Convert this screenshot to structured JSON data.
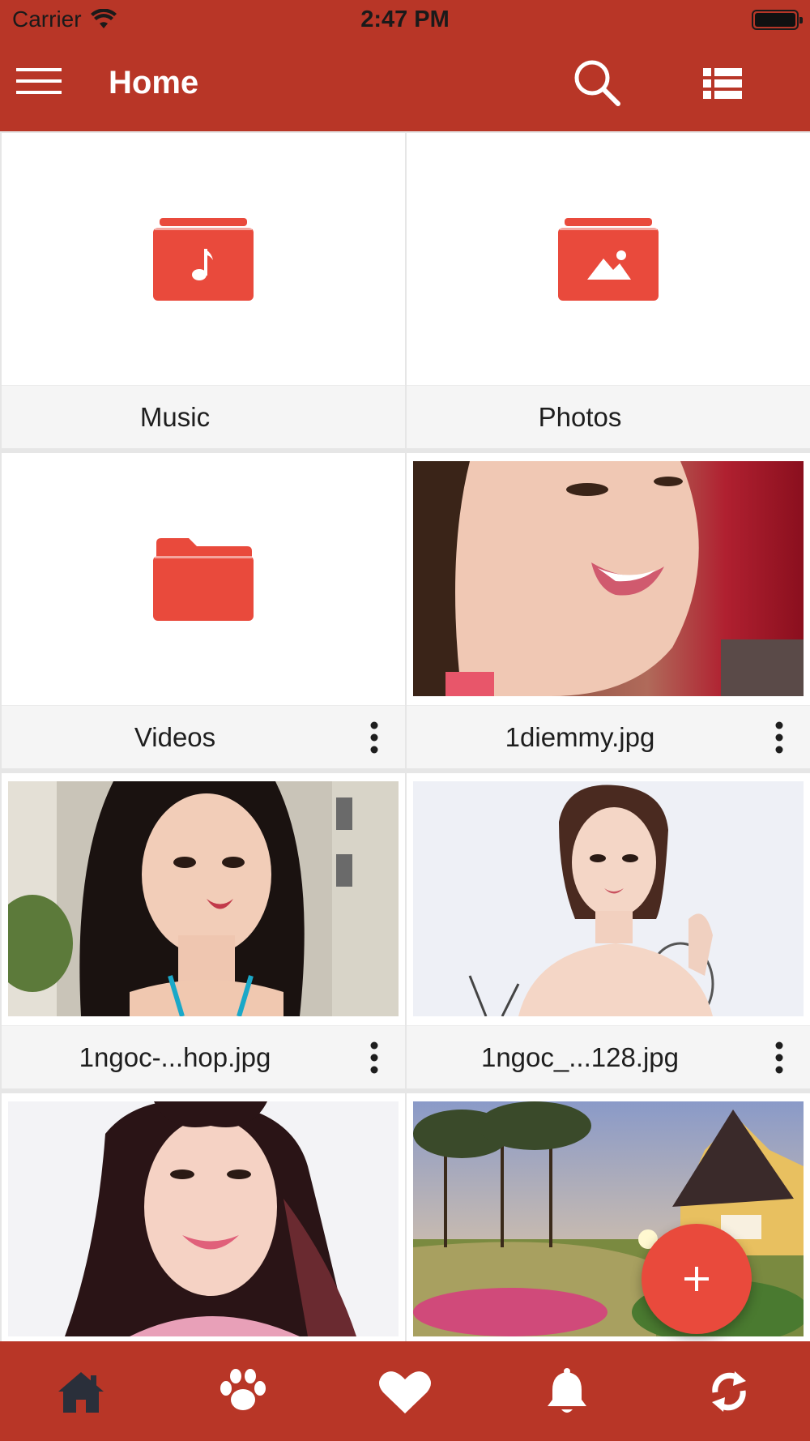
{
  "status_bar": {
    "carrier": "Carrier",
    "time": "2:47 PM"
  },
  "app_bar": {
    "title": "Home",
    "menu_icon": "hamburger-icon",
    "search_icon": "search-icon",
    "list_icon": "list-view-icon"
  },
  "colors": {
    "primary": "#b83627",
    "accent": "#e94a3c",
    "folder": "#e94a3c",
    "inactive_tab": "#ffffff",
    "active_tab": "#2a2f3a"
  },
  "folders": [
    {
      "name": "Music",
      "icon": "music-folder-icon"
    },
    {
      "name": "Photos",
      "icon": "photos-folder-icon"
    },
    {
      "name": "Videos",
      "icon": "folder-icon"
    }
  ],
  "files": [
    {
      "name": "1diemmy.jpg"
    },
    {
      "name": "1ngoc-...hop.jpg"
    },
    {
      "name": "1ngoc_...128.jpg"
    }
  ],
  "bottom_tabs": [
    {
      "id": "home",
      "icon": "home-icon",
      "active": true
    },
    {
      "id": "paw",
      "icon": "paw-icon",
      "active": false
    },
    {
      "id": "favorites",
      "icon": "heart-icon",
      "active": false
    },
    {
      "id": "notifications",
      "icon": "bell-icon",
      "active": false
    },
    {
      "id": "sync",
      "icon": "sync-icon",
      "active": false
    }
  ],
  "fab": {
    "icon": "plus-icon"
  }
}
